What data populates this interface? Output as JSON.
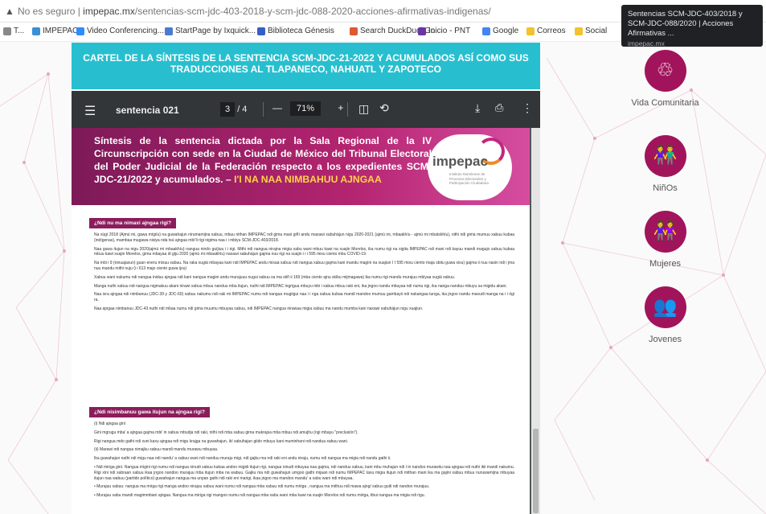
{
  "browser": {
    "security_label": "No es seguro",
    "url_domain": "impepac.mx",
    "url_path": "/sentencias-scm-jdc-403-2018-y-scm-jdc-088-2020-acciones-afirmativas-indigenas/",
    "bookmarks": [
      {
        "label": "T...",
        "color": "#888888"
      },
      {
        "label": "IMPEPAC",
        "color": "#3a8fd6"
      },
      {
        "label": "Video Conferencing...",
        "color": "#2d8cff"
      },
      {
        "label": "StartPage by Ixquick...",
        "color": "#4a7bd0"
      },
      {
        "label": "Biblioteca Génesis",
        "color": "#3360c5"
      },
      {
        "label": "Search DuckDuckGo",
        "color": "#de5833"
      },
      {
        "label": "Inicio - PNT",
        "color": "#6b35a8"
      },
      {
        "label": "Google",
        "color": "#4285f4"
      },
      {
        "label": "Correos",
        "color": "#f2c230"
      },
      {
        "label": "Social",
        "color": "#f2c230"
      }
    ],
    "tooltip": {
      "title": "Sentencias SCM-JDC-403/2018 y SCM-JDC-088/2020 | Acciones Afirmativas ...",
      "domain": "impepac.mx"
    }
  },
  "banner": {
    "text": "CARTEL DE LA SÍNTESIS DE LA SENTENCIA SCM-JDC-21-2022 Y ACUMULADOS ASÍ COMO SUS TRADUCCIONES AL TLAPANECO, NAHUATL Y ZAPOTECO"
  },
  "pdf": {
    "filename": "sentencia 021",
    "page_current": "3",
    "page_total": "/ 4",
    "zoom": "71%",
    "header_text": "Síntesis de la sentencia dictada por la Sala Regional de la IV Circunscripción con sede en la Ciudad de México del Tribunal Electoral del Poder Judicial de la Federación respecto a los expedientes SCM-JDC-21/2022 y acumulados. –",
    "header_highlight": "I'I NA NAA NIMBAHUU AJNGAA",
    "logo_text": "impepac",
    "logo_subtext": "Instituto Morelense de Procesos Electorales y Participación Ciudadana",
    "section1": "¿Ndi nu ma nimaxi ajngaa rigi?",
    "section2": "¿Ndi nisimbanuu gawa itujun na ajngaa rigi?",
    "paragraphs1": [
      "Na xúgí 2018 (Ajmú mi, gawa mígiíu) na guwahajun nirumamijna xabuu, mbuu nithan IMPEPAC ndi gima maxi giñí andu maxawi xabuhájun nigu 2020-2021 (ajmú mi, mbaakhíu - ajmú mi mbatskhíu), nithi ndi gima mumuu xabuu kubaa (indígenas), mambaa mugawa nisiya nda tsú ajngaa mbí'ii rigi nigima naa i i mbiyu SCM-JDC-403/2018.",
      "Naa guwa itujun na nigu 2020(ajmú mi mbaakhíu) nangua nindo guíjiuu i i rigi. Mithi ndi nangua nirajna migia xabu wani mbuu kawi na xuajin Morelos, ika numu rigi na xigita IMPEPAC ndi mani ndi kayuu mandi magujo xabuu kubaa mbuu kawi xuajin Morelos, gima mbayaa di giju 2020 (ajmú mi mbaakhíu) naxawi xabuhájun gajma nuu rigi na xuajin i i i 595 mixu ciento mbu COVID-19.",
      "Na mbi i 9 (ninuajaxun) guun eneru mixuu xabuu. Na raka xugiá mbayaa kani ndi IMPEPAC andu mixaá xabuu ndi nangua xabuu gajma kani mandu magini na xuajiun I I 595 mixu ciento maja sbitu guwa xixu) gajma ii nuu naxin ndi i jma nuu mandu mithi nuju (i i 613 majo ciento guwa ijxu)",
      "Xabuu wani nakumu ndi nangua iniduu ajngaa ndi kani nangua magini andu murajuuu nugui xabuu xa ma stiñ ii 169 (mba ciento ajnu skibu mijmagawa) ika numu rigi mandu murajuu mbiyaa xugiá xabuu.",
      "Manga nuthi xabuu ndi nangua nigmakuu akani nirawi xabuu mbuu nanduu mba itujun, nuthi ndi IMPEPAC ingrigua mbuyu mbi i xabuu mbuu raki eni, ika jngoo nandu mbuyaa ndi numu rigi, ika nanga nanduu mbuyu sa migidu akani.",
      "Naa ixra ajngaa ndi nimbanuu (JDC-39 y JDC-60) xabuu nakumu ndi raki mi IMPEPAC numu ndi nangua mugiigui naa i i nga xabuu kubaa mandi mandoo mumuu gambayii ndi nakangaa tunga, ika jngoo nandu maxudi manga na i i rigi ra.",
      "Naa ajngaa nimbanuu JDC-43 nuthi ndi mbaa numu ndi gima muumu mbuyaa xabuu, ndi IMPEPAC nangua nirawaa migia xabuu ma nandu mumba kani naxawi xabuhájun nigu xuajiun."
    ],
    "paragraphs2": [
      "(i) Ndi ajngaa giní",
      "Gini mgrugu mba' a ajngaa gajma mbi' in xabuu mbudja ndi raki, nithi ndi mba xabuu gima mukrajsa mba mbuu ndi amujhu (ngi mbayu \"preclusión\").",
      "Rigi nangua mdo gathi ndi xuni kaxu ajngaa ndi migu krajga na guwahajun, ikí xabuhajun giido mbuyu kani muminhani ndi nandua xabuu wani.",
      "(ii) Marawi ndi nangua nimajku xabuu mandi mandu murawu mbuyaa.",
      "Ika guwahajun nathi ndi migu naa ndi nandu' a xabuu wani ndi nanduu muraju migi, ndi gajku ma ndi raki eni andu niraju, numu ndi nangua ma migia ndi nandu gathi ii.",
      "• Ndi miriga giní. Nangua migini rigi numu ndi nangua ninudi xabuu kubaa andoo migidi itujun rigi, nangua ninudi mbuyaa naa gajma, ndi nanduu xabuu, kani mbu muhajun ndi I in nandoo murawiiu naa ajngaa ndi nuthi ikii mandi nakumu. Rigi xini ndi xabraan xabuu ikaa jngoo nandoo murajuu mba itujun mba na wabuu. Gajku ma ndi guwahajun umgoo gathi mijaan ndi numu IMPEPAC taxu migia itujun ndi mithan mani ika ma gajini xabuu mbuu nuruwamijna mbuyaa itujun naa wabuu (partido político) guwahajun nangua ma unpan gathi ndi raki eni marigi, ikaa jngoo ma mandoo mandu' a xabu wani ndi mbuyaa.",
      "• Murajuu xabuu: nangua ma mriga rigi manga andoo nirajuu xabuu wani numu ndi nangua mba xabuu ndi numu miriga , nangua ma mithuu ndi mawa ajngí xabuu guiti ndi nandoo murajuu.",
      "• Murajuu xabu mandi magimmbani ajngaa. Nangua ma miriga rigi mangoo numu ndi nangua mba xabu wani mba kawi na xuajin Morelos ndi numu miriga, tibui nangua ma migia ndi rigu."
    ]
  },
  "sidebar": [
    {
      "label": "Vida Comunitaria",
      "icon": "community-icon",
      "glyph": "♲"
    },
    {
      "label": "NiñOs",
      "icon": "children-icon",
      "glyph": "👫"
    },
    {
      "label": "Mujeres",
      "icon": "women-icon",
      "glyph": "👭"
    },
    {
      "label": "Jovenes",
      "icon": "youth-icon",
      "glyph": "👥"
    }
  ],
  "colors": {
    "banner": "#27bfcf",
    "accent": "#a1145b",
    "viewer_toolbar": "#323639",
    "pdf_header": "#8b1d5c"
  }
}
